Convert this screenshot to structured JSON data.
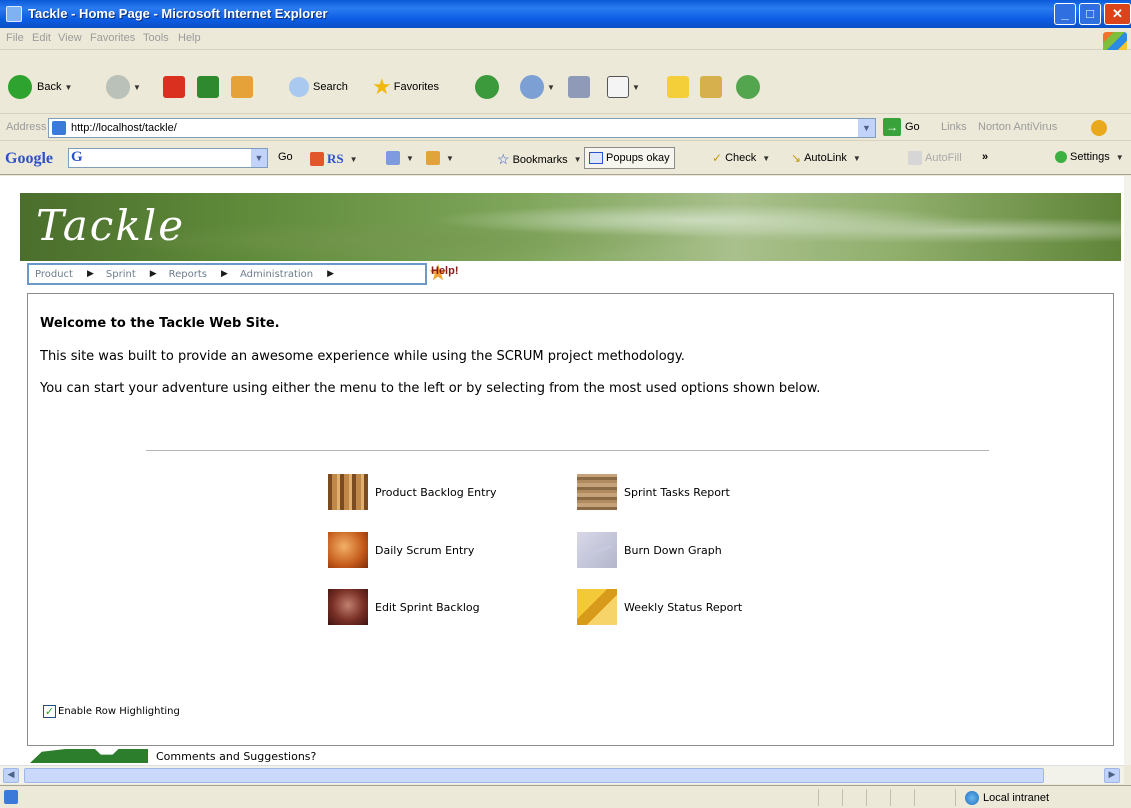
{
  "window": {
    "title": "Tackle - Home Page - Microsoft Internet Explorer",
    "buttons": {
      "minimize": "_",
      "maximize": "□",
      "close": "✕"
    }
  },
  "menu": {
    "items": [
      "File",
      "Edit",
      "View",
      "Favorites",
      "Tools",
      "Help"
    ]
  },
  "toolbar": {
    "back_label": "Back",
    "search_label": "Search",
    "favorites_label": "Favorites"
  },
  "address": {
    "label": "Address",
    "url": "http://localhost/tackle/",
    "go_label": "Go",
    "links_label": "Links",
    "norton_label": "Norton AntiVirus"
  },
  "google_bar": {
    "logo": "Google",
    "box_letter": "G",
    "go_label": "Go",
    "rs_label": "RS",
    "bookmarks_label": "Bookmarks",
    "popups_label": "Popups okay",
    "check_label": "Check",
    "autolink_label": "AutoLink",
    "autofill_label": "AutoFill",
    "more_label": "»",
    "settings_label": "Settings"
  },
  "site": {
    "banner_title": "Tackle",
    "nav": [
      "Product",
      "Sprint",
      "Reports",
      "Administration"
    ],
    "help_label": "Help!",
    "welcome_heading": "Welcome to the Tackle Web Site.",
    "paragraph1": "This site was built to provide an awesome experience while using the SCRUM project methodology.",
    "paragraph2": "You can start your adventure using either the menu to the left or by selecting from the most used options shown below.",
    "quick_links": [
      {
        "label": "Product Backlog Entry"
      },
      {
        "label": "Sprint Tasks Report"
      },
      {
        "label": "Daily Scrum Entry"
      },
      {
        "label": "Burn Down Graph"
      },
      {
        "label": "Edit Sprint Backlog"
      },
      {
        "label": "Weekly Status Report"
      }
    ],
    "row_highlighting_label": "Enable Row Highlighting",
    "row_highlighting_checked": true,
    "footer_link": "Comments and Suggestions?"
  },
  "status": {
    "zone_label": "Local intranet"
  },
  "colors": {
    "titlebar": "#0b5ce3",
    "nav_border": "#6c99c8",
    "banner_green": "#5f8a3a"
  }
}
